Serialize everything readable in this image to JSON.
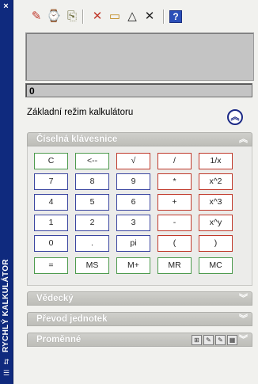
{
  "sidebar": {
    "title": "RYCHLÝ KALKULÁTOR",
    "close_icon": "×",
    "pin_icon": "⇵",
    "menu_icon": "☰"
  },
  "toolbar": {
    "buttons": [
      {
        "name": "clear-icon",
        "glyph": "✎",
        "color": "#c0392b"
      },
      {
        "name": "clear-history-icon",
        "glyph": "⌚",
        "color": "#555"
      },
      {
        "name": "paste-icon",
        "glyph": "⎘",
        "color": "#6b6b3a"
      },
      {
        "name": "get-coordinates-icon",
        "glyph": "✕",
        "color": "#c0392b"
      },
      {
        "name": "distance-icon",
        "glyph": "▭",
        "color": "#c08a20"
      },
      {
        "name": "angle-icon",
        "glyph": "△",
        "color": "#222"
      },
      {
        "name": "intersection-icon",
        "glyph": "✕",
        "color": "#222"
      },
      {
        "name": "help-icon",
        "glyph": "?",
        "color": "#ffffff"
      }
    ]
  },
  "display": {
    "input_value": "0",
    "mode_label": "Základní režim kalkulátoru",
    "mode_toggle_icon": "︽"
  },
  "panels": {
    "keypad": {
      "label": "Číselná klávesnice",
      "chevron": "︽"
    },
    "scientific": {
      "label": "Vědecký",
      "chevron": "︾"
    },
    "units": {
      "label": "Převod jednotek",
      "chevron": "︾"
    },
    "variables": {
      "label": "Proměnné",
      "chevron": "︾"
    }
  },
  "keys": [
    [
      {
        "label": "C",
        "color": "green"
      },
      {
        "label": "<--",
        "color": "green"
      },
      {
        "label": "√",
        "color": "red"
      },
      {
        "label": "/",
        "color": "red"
      },
      {
        "label": "1/x",
        "color": "red"
      }
    ],
    [
      {
        "label": "7",
        "color": "blue"
      },
      {
        "label": "8",
        "color": "blue"
      },
      {
        "label": "9",
        "color": "blue"
      },
      {
        "label": "*",
        "color": "red"
      },
      {
        "label": "x^2",
        "color": "red"
      }
    ],
    [
      {
        "label": "4",
        "color": "blue"
      },
      {
        "label": "5",
        "color": "blue"
      },
      {
        "label": "6",
        "color": "blue"
      },
      {
        "label": "+",
        "color": "red"
      },
      {
        "label": "x^3",
        "color": "red"
      }
    ],
    [
      {
        "label": "1",
        "color": "blue"
      },
      {
        "label": "2",
        "color": "blue"
      },
      {
        "label": "3",
        "color": "blue"
      },
      {
        "label": "-",
        "color": "red"
      },
      {
        "label": "x^y",
        "color": "red"
      }
    ],
    [
      {
        "label": "0",
        "color": "blue"
      },
      {
        "label": ".",
        "color": "blue"
      },
      {
        "label": "pi",
        "color": "blue"
      },
      {
        "label": "(",
        "color": "red"
      },
      {
        "label": ")",
        "color": "red"
      }
    ],
    [
      {
        "label": "=",
        "color": "green"
      },
      {
        "label": "MS",
        "color": "green"
      },
      {
        "label": "M+",
        "color": "green"
      },
      {
        "label": "MR",
        "color": "green"
      },
      {
        "label": "MC",
        "color": "green"
      }
    ]
  ],
  "variables_toolbar": [
    {
      "name": "new-variable-icon",
      "glyph": "⊞"
    },
    {
      "name": "edit-variable-icon",
      "glyph": "✎"
    },
    {
      "name": "delete-variable-icon",
      "glyph": "✎"
    },
    {
      "name": "calculator-icon",
      "glyph": "▦"
    }
  ]
}
